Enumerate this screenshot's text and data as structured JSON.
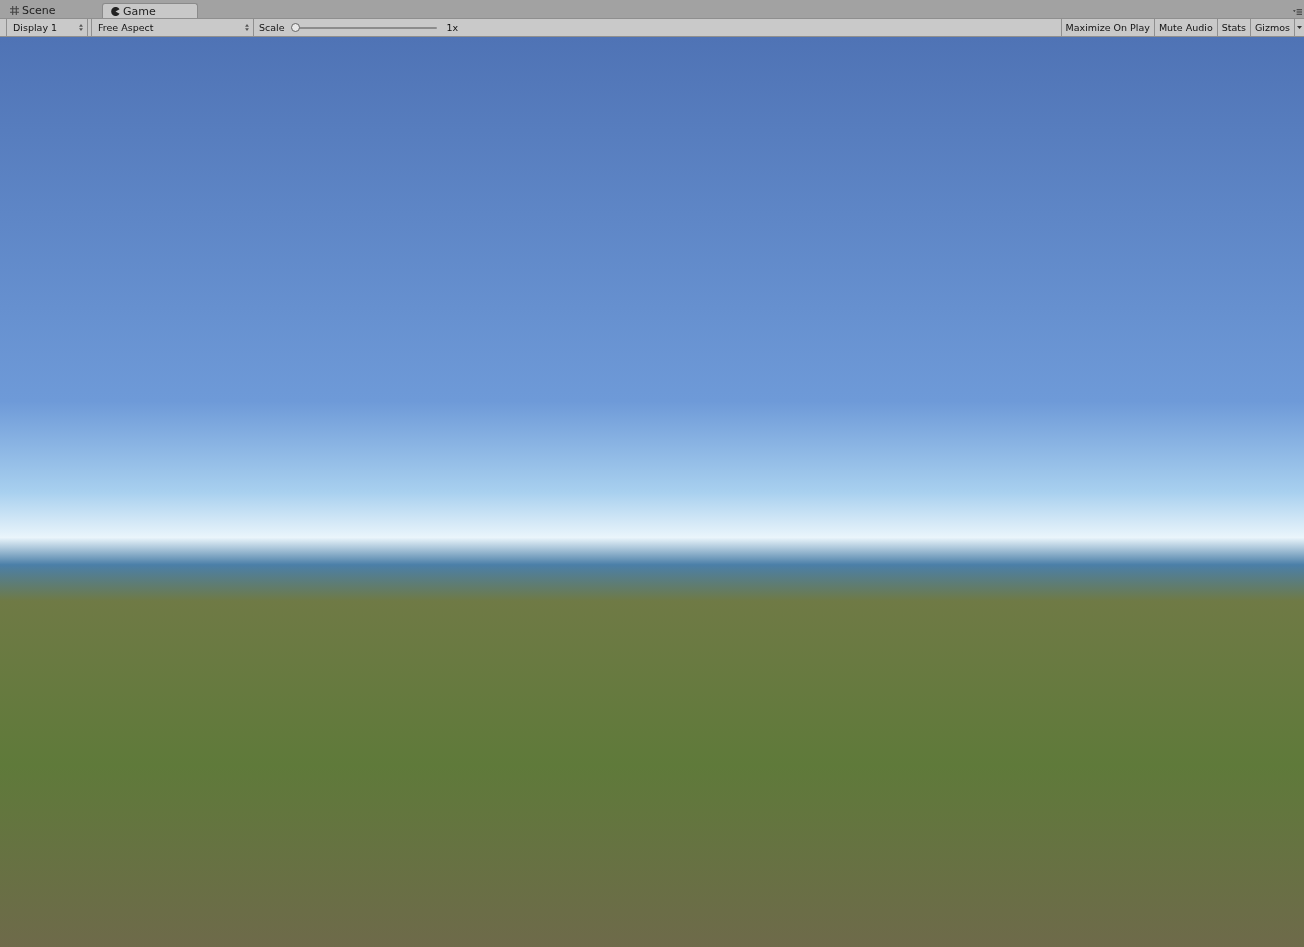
{
  "tabs": [
    {
      "label": "Scene",
      "kind": "scene",
      "selected": false
    },
    {
      "label": "Game",
      "kind": "game",
      "selected": true
    }
  ],
  "toolbar": {
    "display": {
      "value": "Display 1"
    },
    "aspect": {
      "value": "Free Aspect"
    },
    "scale": {
      "label": "Scale",
      "level": 0,
      "reading": "1x"
    },
    "toggles": [
      {
        "label": "Maximize On Play",
        "on": false
      },
      {
        "label": "Mute Audio",
        "on": false
      },
      {
        "label": "Stats",
        "on": false
      },
      {
        "label": "Gizmos",
        "on": false,
        "kind": "dropdown"
      }
    ]
  }
}
